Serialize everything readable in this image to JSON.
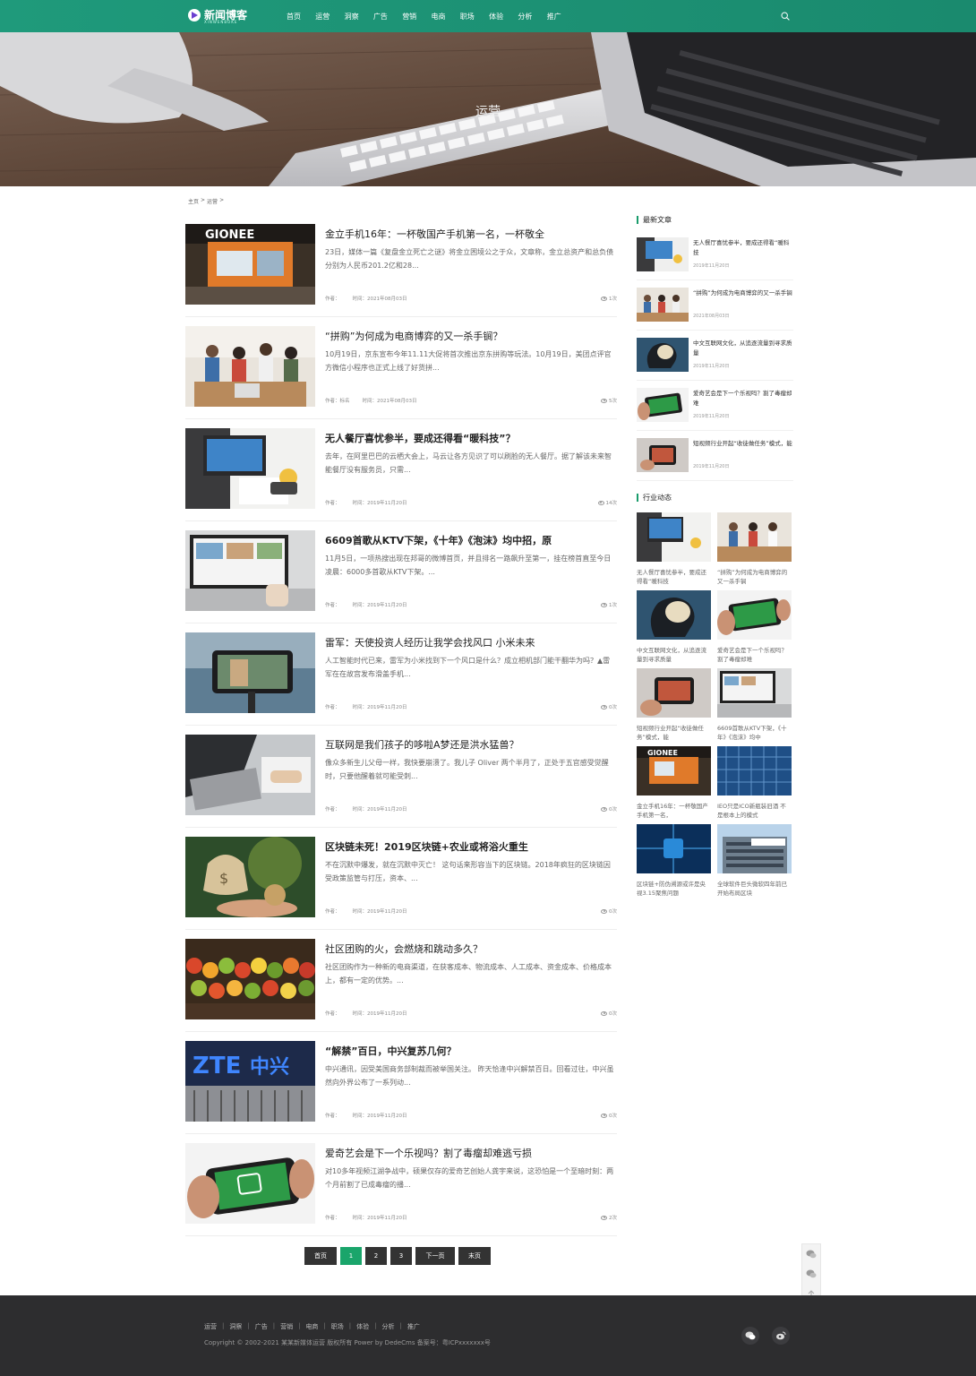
{
  "header": {
    "logo_text": "新闻博客",
    "logo_sub": "XINWENBOKE",
    "nav": [
      "首页",
      "运营",
      "洞察",
      "广告",
      "营销",
      "电商",
      "职场",
      "体验",
      "分析",
      "推广"
    ]
  },
  "banner": {
    "title": "运营"
  },
  "breadcrumb": {
    "home": "主页",
    "sep1": ">",
    "current": "运营",
    "sep2": ">"
  },
  "articles": [
    {
      "title": "金立手机16年：一杯敬国产手机第一名，一杯敬全",
      "desc": "23日，媒体一篇《复盘金立死亡之谜》将金立困境公之于众，文章称，金立总资产和总负债分别为人民币201.2亿和28...",
      "author": "作者：",
      "time": "时间：2021年08月03日",
      "views": "1次"
    },
    {
      "title": "“拼购”为何成为电商博弈的又一杀手锏？",
      "desc": "10月19日，京东宣布今年11.11大促将首次推出京东拼购等玩法。10月19日，美团点评官方微信小程序也正式上线了好货拼...",
      "author": "作者：标名",
      "time": "时间：2021年08月03日",
      "views": "5次"
    },
    {
      "title": "无人餐厅喜忧参半，要成还得看“暖科技”？",
      "desc": "去年，在阿里巴巴的云栖大会上，马云让各方见识了可以刷脸的无人餐厅。据了解该未来智能餐厅没有服务员，只需...",
      "author": "作者：",
      "time": "时间：2019年11月20日",
      "views": "14次"
    },
    {
      "title": "6609首歌从KTV下架，《十年》《泡沫》均中招，原",
      "desc": "11月5日，一项热搜出现在邦哥的微博首页，并且排名一路飙升至第一，挂在榜首直至今日凌晨：6000多首歌从KTV下架。...",
      "author": "作者：",
      "time": "时间：2019年11月20日",
      "views": "1次"
    },
    {
      "title": "雷军：天使投资人经历让我学会找风口 小米未来",
      "desc": "人工智能时代已来，雷军为小米找到下一个风口是什么？成立相机部门能干翻华为吗？▲雷军在在故宫发布滑盖手机...",
      "author": "作者：",
      "time": "时间：2019年11月20日",
      "views": "0次"
    },
    {
      "title": "互联网是我们孩子的哆啦A梦还是洪水猛兽？",
      "desc": "像众多新生儿父母一样，我快要崩溃了。我儿子 Oliver 两个半月了，正处于五官感受觉醒时，只要他醒着就可能受刺...",
      "author": "作者：",
      "time": "时间：2019年11月20日",
      "views": "0次"
    },
    {
      "title": "区块链未死！2019区块链+农业或将浴火重生",
      "desc": "不在沉默中爆发，就在沉默中灭亡！ 这句话来形容当下的区块链。2018年疯狂的区块链因受政策监管与打压，资本、...",
      "author": "作者：",
      "time": "时间：2019年11月20日",
      "views": "0次"
    },
    {
      "title": "社区团购的火，会燃烧和跳动多久？",
      "desc": "社区团购作为一种新的电商渠道，在获客成本、物流成本、人工成本、资金成本、价格成本上，都有一定的优势。...",
      "author": "作者：",
      "time": "时间：2019年11月20日",
      "views": "0次"
    },
    {
      "title": "“解禁”百日，中兴复苏几何？",
      "desc": "中兴通讯，因受美国商务部制裁而被举国关注。 昨天恰逢中兴解禁百日。回看过往，中兴虽然向外界公布了一系列动...",
      "author": "作者：",
      "time": "时间：2019年11月20日",
      "views": "0次"
    },
    {
      "title": "爱奇艺会是下一个乐视吗？割了毒瘤却难逃亏损",
      "desc": "对10多年视频江湖争战中，硕果仅存的爱奇艺创始人龚宇来说，这恐怕是一个至暗时刻：两个月前割了已成毒瘤的播...",
      "author": "作者：",
      "time": "时间：2019年11月20日",
      "views": "2次"
    }
  ],
  "pagination": {
    "first": "首页",
    "p1": "1",
    "p2": "2",
    "p3": "3",
    "next": "下一页",
    "last": "末页"
  },
  "sidebar": {
    "latest_heading": "最新文章",
    "latest": [
      {
        "title": "无人餐厅喜忧参半，要成还得看“暖科技",
        "date": "2019年11月20日"
      },
      {
        "title": "“拼购”为何成为电商博弈的又一杀手锏",
        "date": "2021年08月03日"
      },
      {
        "title": "中文互联网文化，从追逐流量到寻求质量",
        "date": "2019年11月20日"
      },
      {
        "title": "爱奇艺会是下一个乐视吗？割了毒瘤却难",
        "date": "2019年11月20日"
      },
      {
        "title": "短视频行业开起“收徒做任务”模式，能",
        "date": "2019年11月20日"
      }
    ],
    "industry_heading": "行业动态",
    "industry": [
      {
        "title": "无人餐厅喜忧参半，要成还得看“暖科技"
      },
      {
        "title": "“拼购”为何成为电商博弈的又一杀手锏"
      },
      {
        "title": "中文互联网文化，从追逐流量到寻求质量"
      },
      {
        "title": "爱奇艺会是下一个乐视吗？割了毒瘤却难"
      },
      {
        "title": "短视频行业开起“收徒做任务”模式，能"
      },
      {
        "title": "6609首歌从KTV下架，《十年》《泡沫》均中"
      },
      {
        "title": "金立手机16年：一杯敬国产手机第一名，"
      },
      {
        "title": "IEO只是ICO新瓶装旧酒 不是根本上的模式"
      },
      {
        "title": "区块链+防伪溯源或许是央视3.15聚焦问题"
      },
      {
        "title": "全球软件巨头微软四年前已开始布局区块"
      }
    ]
  },
  "footer": {
    "links": [
      "运营",
      "洞察",
      "广告",
      "营销",
      "电商",
      "职场",
      "体验",
      "分析",
      "推广"
    ],
    "sep": "|",
    "copyright": "Copyright © 2002-2021 某某新媒体运营 版权所有 Power by DedeCms 备案号：粤ICPxxxxxxx号"
  }
}
